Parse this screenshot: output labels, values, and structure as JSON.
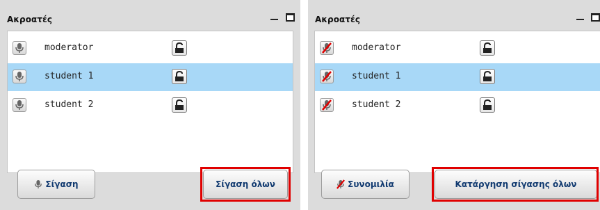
{
  "left_panel": {
    "title": "Ακροατές",
    "rows": [
      {
        "name": "moderator",
        "selected": false,
        "muted": false
      },
      {
        "name": "student 1",
        "selected": true,
        "muted": false
      },
      {
        "name": "student 2",
        "selected": false,
        "muted": false
      }
    ],
    "button_mute": "Σίγαση",
    "button_mute_all": "Σίγαση όλων"
  },
  "right_panel": {
    "title": "Ακροατές",
    "rows": [
      {
        "name": "moderator",
        "selected": false,
        "muted": true
      },
      {
        "name": "student 1",
        "selected": true,
        "muted": true
      },
      {
        "name": "student 2",
        "selected": false,
        "muted": true
      }
    ],
    "button_talk": "Συνομιλία",
    "button_unmute_all": "Κατάργηση σίγασης όλων"
  },
  "colors": {
    "selected_row": "#a8d8f7",
    "highlight_border": "#e00000",
    "button_text": "#113a70"
  }
}
